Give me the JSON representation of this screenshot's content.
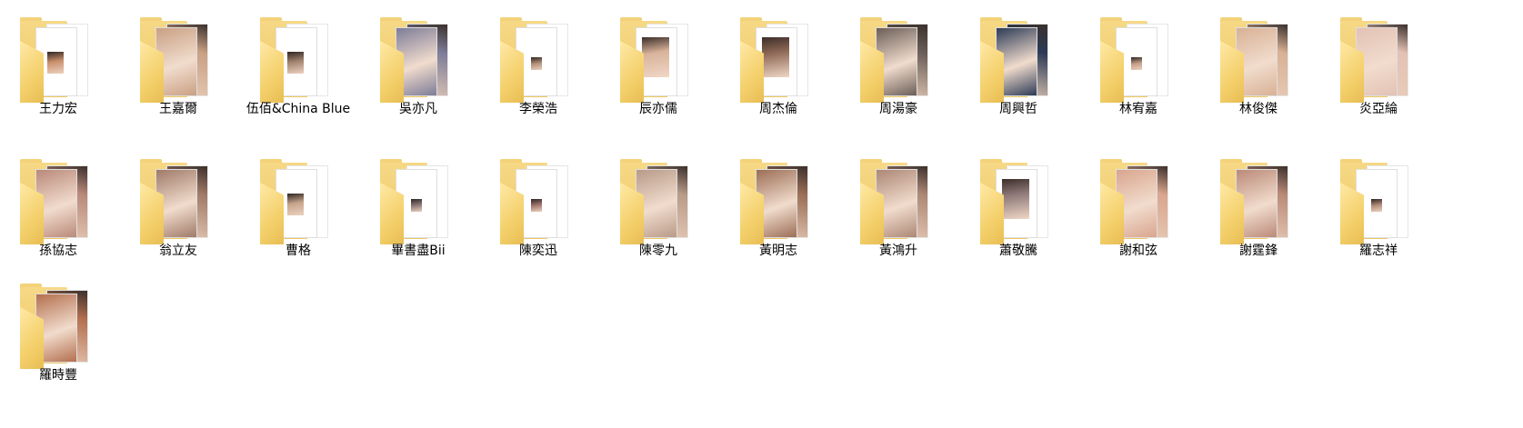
{
  "folders": [
    {
      "name": "王力宏",
      "style": "small",
      "tone": "#c98f6c"
    },
    {
      "name": "王嘉爾",
      "style": "full",
      "tone": "#c9a083"
    },
    {
      "name": "伍佰&China Blue",
      "style": "small",
      "tone": "#a2826f"
    },
    {
      "name": "吳亦凡",
      "style": "full",
      "tone": "#7d7c98"
    },
    {
      "name": "李榮浩",
      "style": "tiny",
      "tone": "#b39179"
    },
    {
      "name": "辰亦儒",
      "style": "medium",
      "tone": "#d8b39a"
    },
    {
      "name": "周杰倫",
      "style": "medium",
      "tone": "#8f6957"
    },
    {
      "name": "周湯豪",
      "style": "full",
      "tone": "#6b5e57"
    },
    {
      "name": "周興哲",
      "style": "full",
      "tone": "#2c3b56"
    },
    {
      "name": "林宥嘉",
      "style": "tiny",
      "tone": "#c5a089"
    },
    {
      "name": "林俊傑",
      "style": "full",
      "tone": "#d8b195"
    },
    {
      "name": "炎亞綸",
      "style": "full",
      "tone": "#e3c2b4"
    },
    {
      "name": "孫協志",
      "style": "full",
      "tone": "#b98979"
    },
    {
      "name": "翁立友",
      "style": "full",
      "tone": "#a07a68"
    },
    {
      "name": "曹格",
      "style": "small",
      "tone": "#c7a48c"
    },
    {
      "name": "畢書盡Bii",
      "style": "tiny",
      "tone": "#8c7a78"
    },
    {
      "name": "陳奕迅",
      "style": "tiny",
      "tone": "#a3776f"
    },
    {
      "name": "陳零九",
      "style": "full",
      "tone": "#b89a88"
    },
    {
      "name": "黃明志",
      "style": "full",
      "tone": "#9b6e56"
    },
    {
      "name": "黃鴻升",
      "style": "full",
      "tone": "#ad8775"
    },
    {
      "name": "蕭敬騰",
      "style": "medium",
      "tone": "#8f7a79"
    },
    {
      "name": "謝和弦",
      "style": "full",
      "tone": "#d9a58e"
    },
    {
      "name": "謝霆鋒",
      "style": "full",
      "tone": "#ba8a78"
    },
    {
      "name": "羅志祥",
      "style": "tiny",
      "tone": "#b38d7b"
    },
    {
      "name": "羅時豐",
      "style": "full",
      "tone": "#b46f4e"
    }
  ]
}
